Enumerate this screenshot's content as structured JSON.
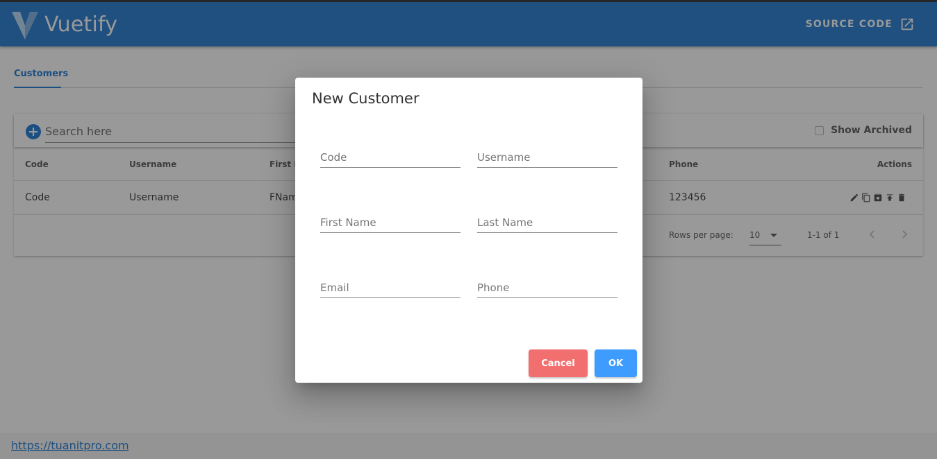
{
  "app": {
    "brand": "Vuetify",
    "source_code_label": "SOURCE CODE"
  },
  "tabs": [
    {
      "label": "Customers"
    }
  ],
  "toolbar": {
    "search_placeholder": "Search here",
    "show_archived_label": "Show Archived"
  },
  "table": {
    "headers": [
      "Code",
      "Username",
      "First Na",
      "Phone",
      "Actions"
    ],
    "rows": [
      {
        "code": "Code",
        "username": "Username",
        "first_name": "FNam",
        "phone": "123456"
      }
    ],
    "action_icons": [
      "pencil-icon",
      "copy-icon",
      "archive-icon",
      "upload-icon",
      "trash-icon"
    ]
  },
  "pagination": {
    "rows_per_page_label": "Rows per page:",
    "rows_per_page_value": "10",
    "range_label": "1-1 of 1"
  },
  "footer": {
    "link_text": "https://tuanitpro.com"
  },
  "dialog": {
    "title": "New Customer",
    "fields": {
      "code": "Code",
      "username": "Username",
      "first_name": "First Name",
      "last_name": "Last Name",
      "email": "Email",
      "phone": "Phone"
    },
    "cancel_label": "Cancel",
    "ok_label": "OK"
  },
  "colors": {
    "app_bar": "#1f78d1",
    "accent": "#1976d2",
    "cancel_button": "#f26f6f",
    "ok_button": "#3f9cff"
  }
}
